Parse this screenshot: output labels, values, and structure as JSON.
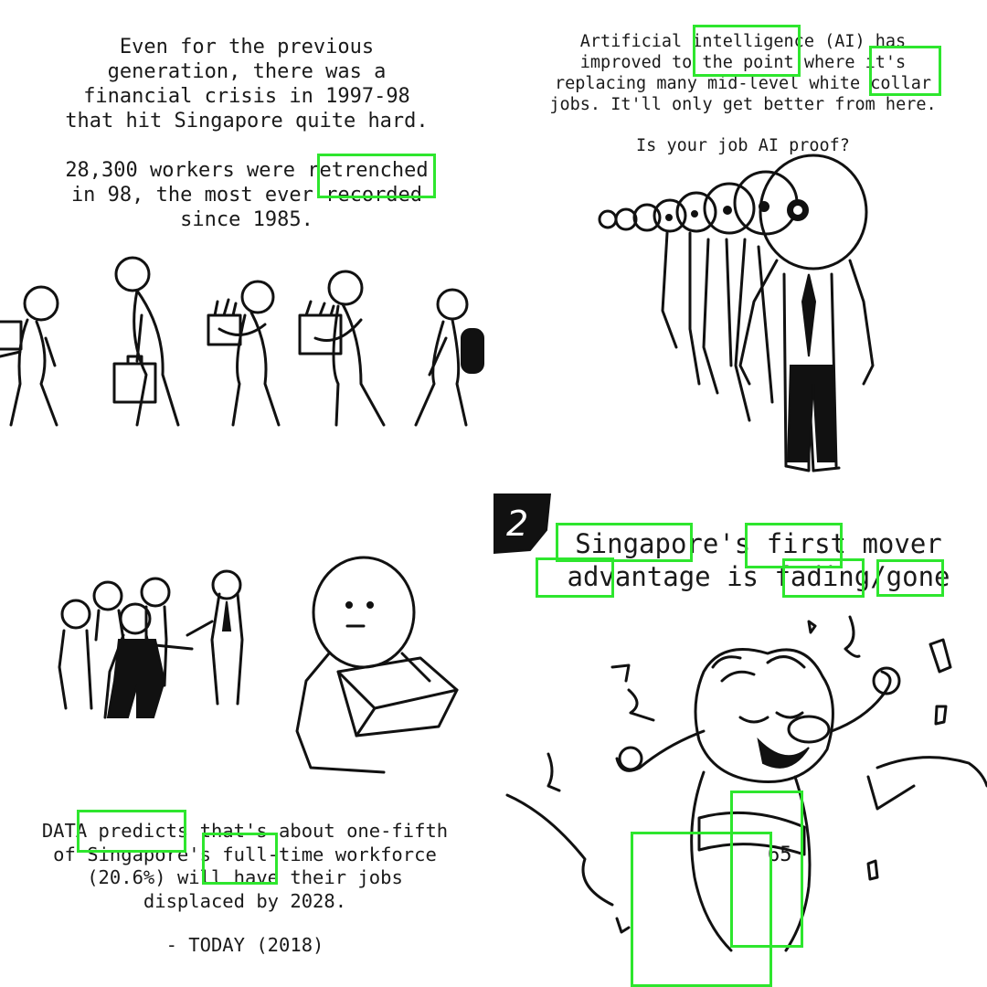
{
  "panel_top_left": {
    "lines": [
      "Even for the previous",
      "generation, there was a",
      "financial crisis in 1997-98",
      "that hit Singapore quite hard."
    ],
    "lines2": [
      "28,300 workers were retrenched",
      "in 98, the most ever recorded",
      "since 1985."
    ]
  },
  "panel_top_right": {
    "lines": [
      "Artificial intelligence (AI) has",
      "improved to the point where it's",
      "replacing many mid-level white collar",
      "jobs. It'll only get better from here."
    ],
    "question": "Is your job AI proof?"
  },
  "panel_bottom_left": {
    "lines": [
      "DATA predicts that's about one-fifth",
      "of Singapore's full-time workforce",
      "(20.6%) will have their jobs",
      "displaced by 2028."
    ],
    "source": "- TODAY (2018)"
  },
  "panel_bottom_right": {
    "badge_number": "2",
    "title_line1": "Singapore's first mover",
    "title_line2": "advantage is fading/gone",
    "sash_number": "65"
  },
  "colors": {
    "highlight": "#2ee62e",
    "ink": "#111111",
    "background": "#ffffff"
  }
}
